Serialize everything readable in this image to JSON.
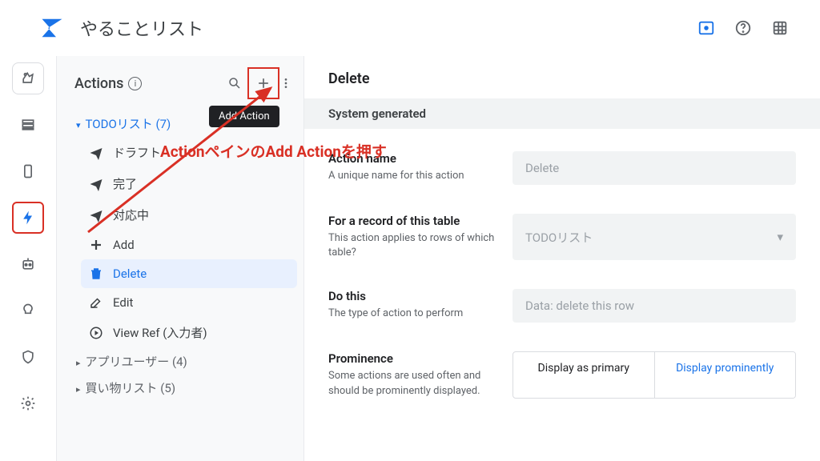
{
  "header": {
    "app_title": "やることリスト"
  },
  "pane": {
    "title": "Actions",
    "tooltip_add": "Add Action",
    "groups": [
      {
        "label": "TODOリスト (7)",
        "expanded": true
      },
      {
        "label": "アプリユーザー (4)",
        "expanded": false
      },
      {
        "label": "買い物リスト (5)",
        "expanded": false
      }
    ],
    "items": [
      {
        "label": "ドラフト",
        "icon": "plane"
      },
      {
        "label": "完了",
        "icon": "plane"
      },
      {
        "label": "対応中",
        "icon": "plane"
      },
      {
        "label": "Add",
        "icon": "plus"
      },
      {
        "label": "Delete",
        "icon": "trash",
        "selected": true
      },
      {
        "label": "Edit",
        "icon": "edit"
      },
      {
        "label": "View Ref (入力者)",
        "icon": "goto"
      }
    ]
  },
  "detail": {
    "title": "Delete",
    "section": "System generated",
    "fields": {
      "name": {
        "label": "Action name",
        "help": "A unique name for this action",
        "value": "Delete"
      },
      "table": {
        "label": "For a record of this table",
        "help": "This action applies to rows of which table?",
        "value": "TODOリスト"
      },
      "do": {
        "label": "Do this",
        "help": "The type of action to perform",
        "value": "Data: delete this row"
      },
      "prom": {
        "label": "Prominence",
        "help": "Some actions are used often and should be prominently displayed.",
        "opt1": "Display as primary",
        "opt2": "Display prominently"
      }
    }
  },
  "annotation": {
    "text": "ActionペインのAdd Actionを押す"
  }
}
